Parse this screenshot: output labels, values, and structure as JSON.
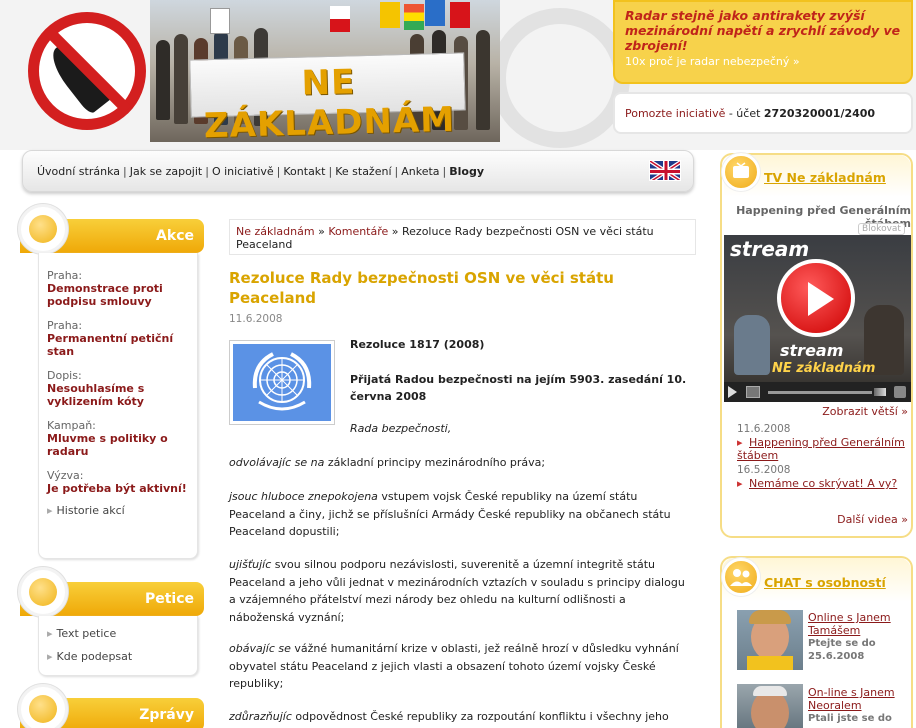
{
  "header": {
    "banner_text": "NE ZÁKLADNÁM",
    "radar": {
      "headline": "Radar stejně jako antirakety zvýší mezinárodní napětí a zrychlí závody ve zbrojení!",
      "link": "10x proč je radar nebezpečný »"
    },
    "support": {
      "link": "Pomozte iniciativě",
      "text": " - účet ",
      "account": "2720320001/2400"
    }
  },
  "nav": {
    "items": [
      "Úvodní stránka",
      "Jak se zapojit",
      "O iniciativě",
      "Kontakt",
      "Ke stažení",
      "Anketa"
    ],
    "blogy": "Blogy",
    "separator": "|",
    "flag_icon": "uk-flag-icon"
  },
  "left": {
    "akce": {
      "title": "Akce",
      "items": [
        {
          "category": "Praha:",
          "title": "Demonstrace proti podpisu smlouvy"
        },
        {
          "category": "Praha:",
          "title": "Permanentní petiční stan"
        },
        {
          "category": "Dopis:",
          "title": "Nesouhlasíme s vyklizením kóty"
        },
        {
          "category": "Kampaň:",
          "title": "Mluvme s politiky o radaru"
        },
        {
          "category": "Výzva:",
          "title": "Je potřeba být aktivní!"
        }
      ],
      "history": "Historie akcí"
    },
    "petice": {
      "title": "Petice",
      "links": [
        "Text petice",
        "Kde podepsat"
      ]
    },
    "zpravy": {
      "title": "Zprávy"
    }
  },
  "main": {
    "breadcrumb": {
      "home": "Ne základnám",
      "sep": " » ",
      "section": "Komentáře",
      "current": "Rezoluce Rady bezpečnosti OSN ve věci státu Peaceland"
    },
    "title": "Rezoluce Rady bezpečnosti OSN ve věci státu Peaceland",
    "date": "11.6.2008",
    "resolution_id": "Rezoluce 1817 (2008)",
    "adopted": "Přijatá Radou bezpečnosti na jejím 5903. zasedání 10. června 2008",
    "council": "Rada bezpečnosti,",
    "paragraphs": [
      {
        "lead": "odvolávajíc se na",
        "text": " základní principy mezinárodního práva;"
      },
      {
        "lead": "jsouc hluboce znepokojena",
        "text": " vstupem vojsk České republiky na území státu Peaceland a činy, jichž se příslušníci Armády České republiky na občanech státu Peaceland dopustili;"
      },
      {
        "lead": "ujišťujíc",
        "text": " svou silnou podporu nezávislosti, suverenitě a územní integritě státu Peaceland a jeho vůli jednat v mezinárodních vztazích v souladu s principy dialogu a vzájemného přátelství mezi národy bez ohledu na kulturní odlišnosti a náboženská vyznání;"
      },
      {
        "lead": "obávajíc se",
        "text": " vážné humanitární krize v oblasti, jež reálně hrozí v důsledku vyhnání obyvatel státu Peaceland z jejich vlasti a obsazení tohoto území vojsky České republiky;"
      },
      {
        "lead": "zdůrazňujíc",
        "text": " odpovědnost České republiky za rozpoutání konfliktu i všechny jeho"
      }
    ]
  },
  "right": {
    "tv": {
      "title": "TV Ne základnám",
      "caption": "Happening před Generálním štábem",
      "block_label": "Blokovat",
      "video_logo": "stream",
      "video_overlay": "NE základnám",
      "enlarge": "Zobrazit větší »",
      "items": [
        {
          "date": "11.6.2008",
          "title": "Happening před Generálním štábem"
        },
        {
          "date": "16.5.2008",
          "title": "Nemáme co skrývat! A vy?"
        }
      ],
      "more": "Další videa »"
    },
    "chat": {
      "title": "CHAT s osobností",
      "items": [
        {
          "title": "Online s Janem Tamášem",
          "sub": "Ptejte se do 25.6.2008"
        },
        {
          "title": "On-line s Janem Neoralem",
          "sub": "Ptali jste se do"
        }
      ]
    }
  },
  "colors": {
    "accent_yellow": "#f0b418",
    "link_dark_red": "#8b1a1a",
    "title_gold": "#d9a400",
    "no_sign_red": "#d31f1f"
  }
}
